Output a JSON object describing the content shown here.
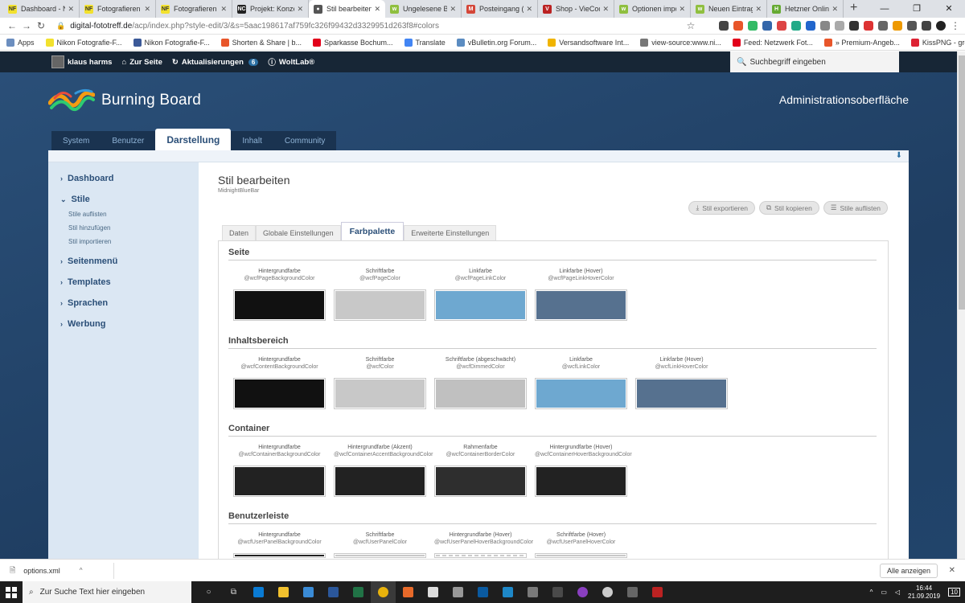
{
  "browser": {
    "tabs": [
      {
        "icon": "NF",
        "label": "Dashboard - Net",
        "color": "#f2e12e"
      },
      {
        "icon": "NF",
        "label": "Fotografieren ler",
        "color": "#f2e12e"
      },
      {
        "icon": "NF",
        "label": "Fotografieren ler",
        "color": "#f2e12e"
      },
      {
        "icon": "NC",
        "label": "Projekt: Konzertf",
        "color": "#222"
      },
      {
        "icon": "●",
        "label": "Stil bearbeiten -",
        "color": "#555",
        "active": true
      },
      {
        "icon": "w",
        "label": "Ungelesene Beit",
        "color": "#8fbf3f"
      },
      {
        "icon": "M",
        "label": "Posteingang (2)",
        "color": "#d44638"
      },
      {
        "icon": "V",
        "label": "Shop - VieCode",
        "color": "#b22"
      },
      {
        "icon": "w",
        "label": "Optionen import",
        "color": "#8fbf3f"
      },
      {
        "icon": "w",
        "label": "Neuen Eintrag e",
        "color": "#8fbf3f"
      },
      {
        "icon": "H",
        "label": "Hetzner Online G",
        "color": "#6a3"
      }
    ],
    "new_tab": "+",
    "win_min": "—",
    "win_max": "❐",
    "win_close": "✕",
    "url_host": "digital-fototreff.de",
    "url_path": "/acp/index.php?style-edit/3/&s=5aac198617af759fc326f99432d3329951d263f8#colors",
    "bookmarks": [
      {
        "label": "Apps",
        "color": "#6c8ebf"
      },
      {
        "label": "Nikon Fotografie-F...",
        "color": "#f2e12e"
      },
      {
        "label": "Nikon Fotografie-F...",
        "color": "#3b5998"
      },
      {
        "label": "Shorten & Share | b...",
        "color": "#e8562a"
      },
      {
        "label": "Sparkasse Bochum...",
        "color": "#e2001a"
      },
      {
        "label": "Translate",
        "color": "#4285f4"
      },
      {
        "label": "vBulletin.org Forum...",
        "color": "#5b8cc1"
      },
      {
        "label": "Versandsoftware Int...",
        "color": "#f0b400"
      },
      {
        "label": "view-source:www.ni...",
        "color": "#777"
      },
      {
        "label": "Feed: Netzwerk Fot...",
        "color": "#e2001a"
      },
      {
        "label": "» Premium-Angeb...",
        "color": "#e8562a"
      },
      {
        "label": "KissPNG - größtes...",
        "color": "#d23"
      },
      {
        "label": "Bild für Facebook Li...",
        "color": "#e0a030"
      }
    ]
  },
  "acp": {
    "user": "klaus harms",
    "to_site": "Zur Seite",
    "updates": "Aktualisierungen",
    "updates_count": "6",
    "woltlab": "WoltLab®",
    "search_placeholder": "Suchbegriff eingeben",
    "logo_text": "Burning Board",
    "head_title": "Administrationsoberfläche",
    "main_nav": [
      "System",
      "Benutzer",
      "Darstellung",
      "Inhalt",
      "Community"
    ],
    "active_main_nav": "Darstellung"
  },
  "sidebar": {
    "dashboard": "Dashboard",
    "stile": "Stile",
    "stile_items": [
      "Stile auflisten",
      "Stil hinzufügen",
      "Stil importieren"
    ],
    "sections": [
      "Seitenmenü",
      "Templates",
      "Sprachen",
      "Werbung"
    ]
  },
  "page": {
    "title": "Stil bearbeiten",
    "subtitle": "MidnightBlueBar",
    "buttons": [
      "Stil exportieren",
      "Stil kopieren",
      "Stile auflisten"
    ],
    "tabs": [
      "Daten",
      "Globale Einstellungen",
      "Farbpalette",
      "Erweiterte Einstellungen"
    ],
    "active_tab": "Farbpalette",
    "sections": [
      {
        "title": "Seite",
        "swatches": [
          {
            "label": "Hintergrundfarbe",
            "var": "@wcfPageBackgroundColor",
            "color": "#111111"
          },
          {
            "label": "Schriftfarbe",
            "var": "@wcfPageColor",
            "color": "#c8c8c8"
          },
          {
            "label": "Linkfarbe",
            "var": "@wcfPageLinkColor",
            "color": "#6ea8d0"
          },
          {
            "label": "Linkfarbe (Hover)",
            "var": "@wcfPageLinkHoverColor",
            "color": "#56718f"
          }
        ]
      },
      {
        "title": "Inhaltsbereich",
        "swatches": [
          {
            "label": "Hintergrundfarbe",
            "var": "@wcfContentBackgroundColor",
            "color": "#111111"
          },
          {
            "label": "Schriftfarbe",
            "var": "@wcfColor",
            "color": "#c8c8c8"
          },
          {
            "label": "Schriftfarbe (abgeschwächt)",
            "var": "@wcfDimmedColor",
            "color": "#c0c0c0"
          },
          {
            "label": "Linkfarbe",
            "var": "@wcfLinkColor",
            "color": "#6ea8d0"
          },
          {
            "label": "Linkfarbe (Hover)",
            "var": "@wcfLinkHoverColor",
            "color": "#56718f"
          }
        ]
      },
      {
        "title": "Container",
        "swatches": [
          {
            "label": "Hintergrundfarbe",
            "var": "@wcfContainerBackgroundColor",
            "color": "#222222"
          },
          {
            "label": "Hintergrundfarbe (Akzent)",
            "var": "@wcfContainerAccentBackgroundColor",
            "color": "#222222"
          },
          {
            "label": "Rahmenfarbe",
            "var": "@wcfContainerBorderColor",
            "color": "#2e2e2e"
          },
          {
            "label": "Hintergrundfarbe (Hover)",
            "var": "@wcfContainerHoverBackgroundColor",
            "color": "#222222"
          }
        ]
      },
      {
        "title": "Benutzerleiste",
        "swatches": [
          {
            "label": "Hintergrundfarbe",
            "var": "@wcfUserPanelBackgroundColor",
            "color": "#222222"
          },
          {
            "label": "Schriftfarbe",
            "var": "@wcfUserPanelColor",
            "color": "#c8c8c8"
          },
          {
            "label": "Hintergrundfarbe (Hover)",
            "var": "@wcfUserPanelHoverBackgroundColor",
            "color": "#cccccc",
            "dotted": true
          },
          {
            "label": "Schriftfarbe (Hover)",
            "var": "@wcfUserPanelHoverColor",
            "color": "#c8c8c8"
          }
        ]
      }
    ]
  },
  "download_bar": {
    "file": "options.xml",
    "show_all": "Alle anzeigen"
  },
  "taskbar": {
    "search_placeholder": "Zur Suche Text hier eingeben",
    "time": "16:44",
    "date": "21.09.2019",
    "notif_count": "10"
  }
}
